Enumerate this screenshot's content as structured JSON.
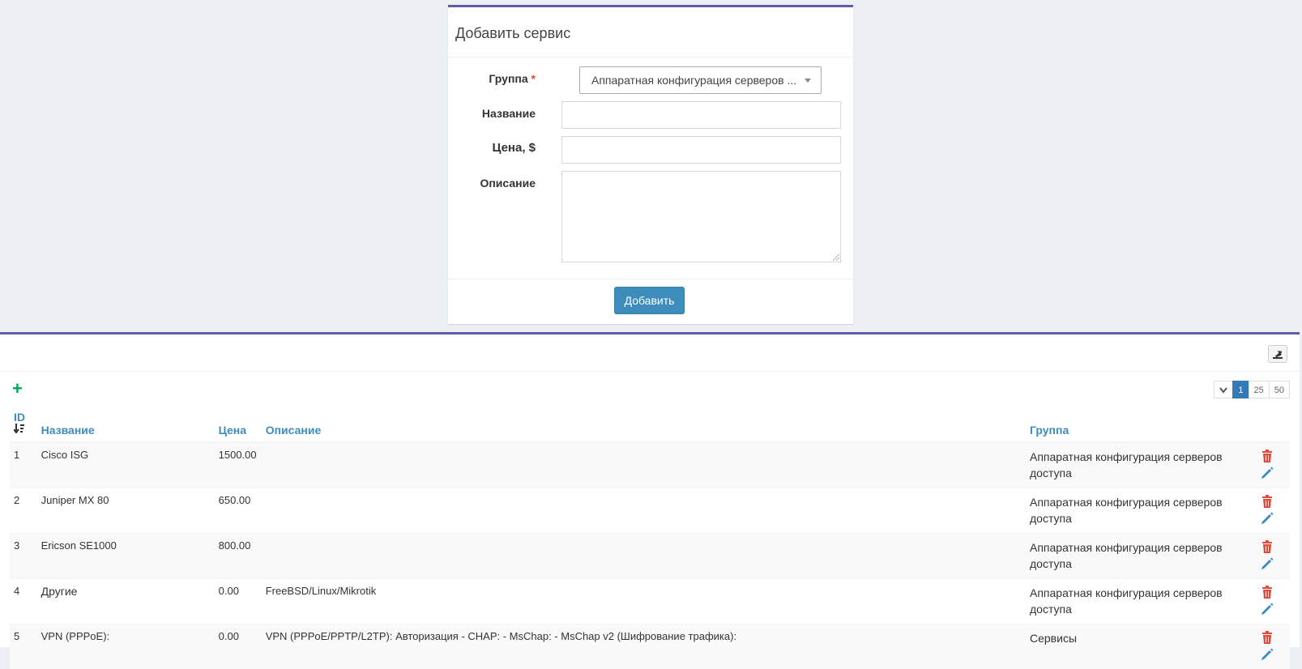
{
  "form": {
    "title": "Добавить сервис",
    "group_label": "Группа",
    "group_required": "*",
    "group_value": "Аппаратная конфигурация серверов ...",
    "name_label": "Название",
    "name_value": "",
    "price_label": "Цена, $",
    "price_value": "",
    "description_label": "Описание",
    "description_value": "",
    "submit_label": "Добавить"
  },
  "toolbar": {
    "add_icon": "plus-icon",
    "export_icon": "export-icon",
    "page_size_options": [
      "1",
      "25",
      "50"
    ],
    "active_page_size": "1"
  },
  "table": {
    "columns": {
      "id": "ID",
      "name": "Название",
      "price": "Цена",
      "description": "Описание",
      "group": "Группа"
    },
    "rows": [
      {
        "id": "1",
        "name": "Cisco ISG",
        "price": "1500.00",
        "description": "",
        "group": "Аппаратная конфигурация серверов доступа"
      },
      {
        "id": "2",
        "name": "Juniper MX 80",
        "price": "650.00",
        "description": "",
        "group": "Аппаратная конфигурация серверов доступа"
      },
      {
        "id": "3",
        "name": "Ericson SE1000",
        "price": "800.00",
        "description": "",
        "group": "Аппаратная конфигурация серверов доступа"
      },
      {
        "id": "4",
        "name": "Другие",
        "price": "0.00",
        "description": "FreeBSD/Linux/Mikrotik",
        "group": "Аппаратная конфигурация серверов доступа"
      },
      {
        "id": "5",
        "name": "VPN (PPPoE):",
        "price": "0.00",
        "description": "VPN (PPPoE/PPTP/L2TP): Авторизация - CHAP: - MsChap: - MsChap v2 (Шифрование трафика):",
        "group": "Сервисы"
      }
    ]
  },
  "colors": {
    "accent": "#605ca8",
    "primary": "#3c8dbc",
    "delete": "#dd4b39",
    "add": "#00a65a"
  }
}
